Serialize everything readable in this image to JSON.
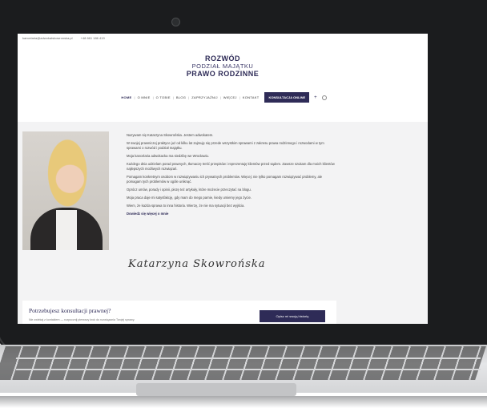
{
  "topbar": {
    "email": "kancelaria@adwokatskowronska.pl",
    "phone": "+48 661 186 419"
  },
  "logo": {
    "line1": "ROZWÓD",
    "line2": "PODZIAŁ MAJĄTKU",
    "line3": "PRAWO RODZINNE"
  },
  "nav": {
    "items": [
      "HOME",
      "O MNIE",
      "O TOBIE",
      "BLOG",
      "ZAPRZYJAŹNIJ",
      "WIĘCEJ",
      "KONTAKT"
    ],
    "cta": "KONSULTACJA ONLINE",
    "plus": "+"
  },
  "about": {
    "p1": "Nazywam się Katarzyna Skowrońska. Jestem adwokatem.",
    "p2": "W swojej prawniczej praktyce już od kilku lat zajmuję się przede wszystkim sprawami z zakresu prawa rodzinnego i rozwodami w tym sprawami o rozwód i podział majątku.",
    "p3": "Moja kancelaria adwokacka ma siedzibę we Wrocławiu.",
    "p4": "Każdego dnia udzielam porad prawnych, tłumaczę treść przepisów i reprezentuję klientów przed sądem. Zawsze szukam dla moich klientów najlepszych możliwych rozwiązań.",
    "p5": "Pomagam konkretnym osobom w rozwiązywaniu ich prywatnych problemów. Więcej: nie tylko pomagam rozwiązywać problemy, ale pomagam tych problemów w ogóle uniknąć.",
    "p6": "Oprócz umów, porady i opinii, piszę też artykuły, które możecie przeczytać na blogu.",
    "p7": "Moja praca daje mi satysfakcję, gdy mam do mego parnie, kiedy umiemy jego życie.",
    "p8": "Wiem, że każda sprawa to inna historia. Wierzę, że nie ma sytuacji bez wyjścia.",
    "more_link": "Dowiedz się więcej o mnie",
    "signature": "Katarzyna Skowrońska"
  },
  "consultation": {
    "title": "Potrzebujesz konsultacji prawnej?",
    "subtitle": "Nie zwlekaj z kontaktem — rozpocznij pierwszy krok do rozwiązania Twojej sprawy.",
    "button": "Opisz mi swoją historię"
  }
}
